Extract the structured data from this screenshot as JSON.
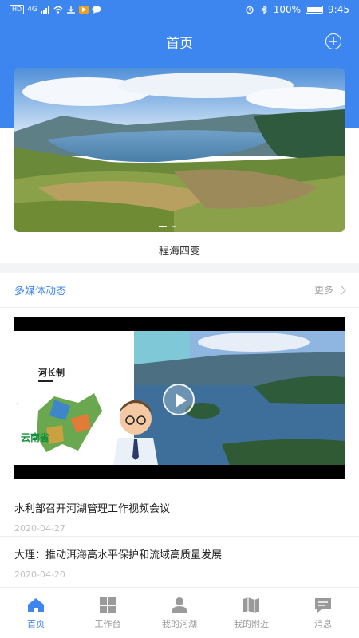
{
  "status_bar": {
    "left_badges": [
      "HD",
      "4G"
    ],
    "battery_text": "100%",
    "time": "9:45"
  },
  "header": {
    "title": "首页"
  },
  "banner": {
    "caption": "程海四变"
  },
  "multimedia": {
    "title": "多媒体动态",
    "more_label": "更多",
    "video": {
      "label": "河长制",
      "province": "云南省"
    }
  },
  "news": [
    {
      "title": "水利部召开河湖管理工作视频会议",
      "date": "2020-04-27"
    },
    {
      "title": "大理：推动洱海高水平保护和流域高质量发展",
      "date": "2020-04-20"
    }
  ],
  "nav": {
    "items": [
      {
        "label": "首页",
        "icon": "home-icon",
        "active": true
      },
      {
        "label": "工作台",
        "icon": "grid-icon"
      },
      {
        "label": "我的河湖",
        "icon": "person-icon"
      },
      {
        "label": "我的附近",
        "icon": "map-icon"
      },
      {
        "label": "消息",
        "icon": "message-icon"
      }
    ]
  },
  "colors": {
    "primary": "#3d86f0",
    "muted": "#9a9a9a"
  }
}
